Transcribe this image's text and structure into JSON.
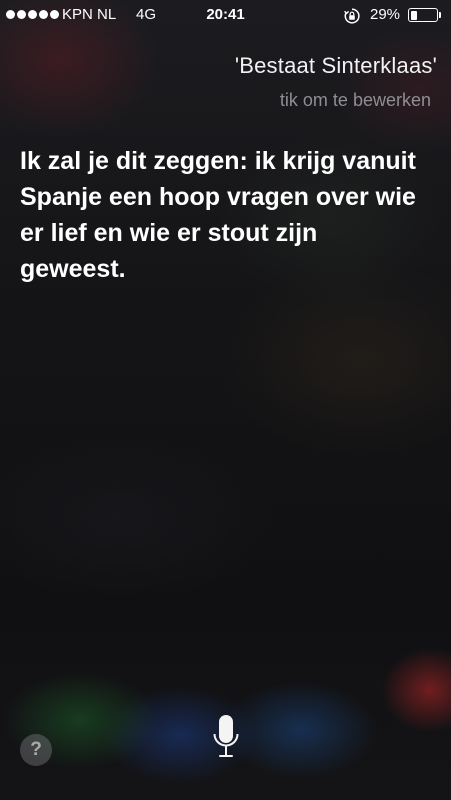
{
  "status_bar": {
    "carrier": "KPN NL",
    "network": "4G",
    "time": "20:41",
    "battery_percent": "29%",
    "battery_level": 0.29,
    "icons": [
      "signal-dots-icon",
      "orientation-lock-icon",
      "battery-icon"
    ]
  },
  "siri": {
    "query": "'Bestaat Sinterklaas'",
    "edit_hint": "tik om te bewerken",
    "answer": "Ik zal je dit zeggen: ik krijg vanuit Spanje een hoop vragen over wie er lief en wie er stout zijn geweest."
  },
  "controls": {
    "help_label": "?",
    "icons": [
      "help-icon",
      "microphone-icon"
    ]
  },
  "colors": {
    "text": "#ffffff",
    "hint": "#8e8e93"
  }
}
